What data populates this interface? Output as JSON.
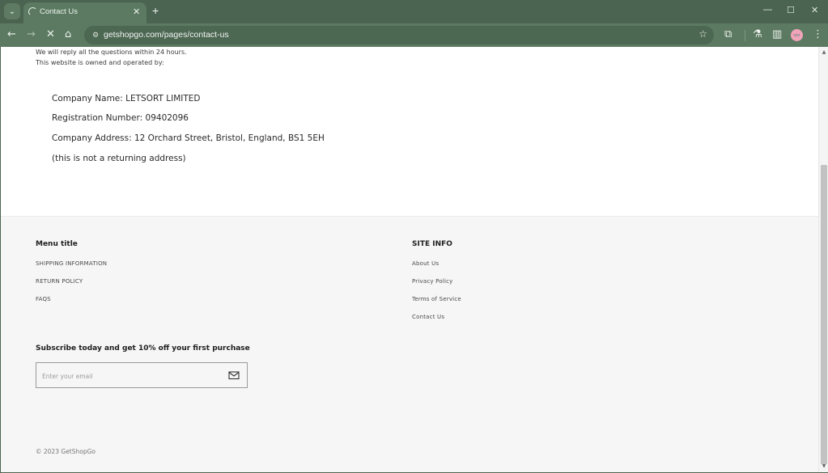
{
  "browser": {
    "tab": {
      "title": "Contact Us",
      "loading": true
    },
    "new_tab_label": "+",
    "tab_search_icon": "chevron-down-icon",
    "window_controls": {
      "minimize": "—",
      "maximize": "☐",
      "close": "✕"
    },
    "toolbar": {
      "back": "←",
      "forward": "→",
      "stop": "✕",
      "home": "⌂",
      "site_info": "⚙",
      "url": "getshopgo.com/pages/contact-us",
      "bookmark": "☆",
      "extensions": "⧉",
      "labs": "⚗",
      "side_panel": "▥",
      "profile": "👓",
      "menu": "⋮"
    }
  },
  "page": {
    "intro": {
      "reply_note": "We will reply all the questions within 24 hours.",
      "owned_note": "This website is owned and operated by:"
    },
    "company": {
      "name": "Company Name: LETSORT LIMITED",
      "registration": "Registration Number: 09402096",
      "address": "Company Address: 12 Orchard Street, Bristol, England, BS1 5EH",
      "note": "(this is not a returning address)"
    },
    "footer": {
      "menu": {
        "title": "Menu title",
        "links": [
          "SHIPPING INFORMATION",
          "RETURN POLICY",
          "FAQS"
        ]
      },
      "site_info": {
        "title": "SITE INFO",
        "links": [
          "About Us",
          "Privacy Policy",
          "Terms of Service",
          "Contact Us"
        ]
      },
      "subscribe": {
        "title": "Subscribe today and get 10% off your first purchase",
        "placeholder": "Enter your email",
        "value": ""
      },
      "copyright": "© 2023 GetShopGo"
    }
  },
  "colors": {
    "browser_frame": "#4b6451",
    "toolbar": "#5b7a61",
    "footer_bg": "#f6f6f6"
  }
}
